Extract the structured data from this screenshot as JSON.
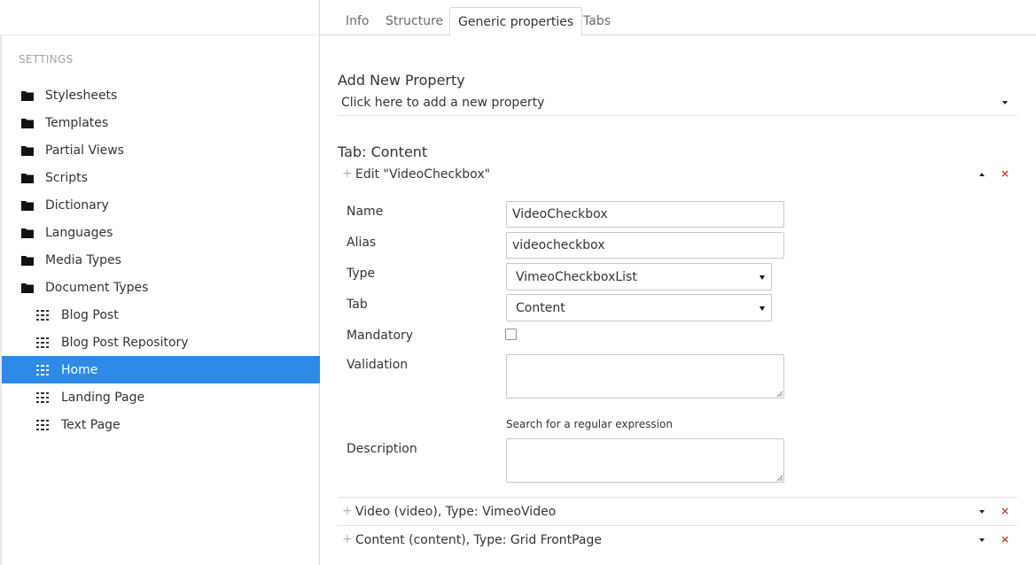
{
  "sidebar": {
    "heading": "SETTINGS",
    "folders": [
      {
        "label": "Stylesheets",
        "icon": "folder-icon"
      },
      {
        "label": "Templates",
        "icon": "folder-icon"
      },
      {
        "label": "Partial Views",
        "icon": "folder-icon"
      },
      {
        "label": "Scripts",
        "icon": "folder-icon"
      },
      {
        "label": "Dictionary",
        "icon": "folder-icon"
      },
      {
        "label": "Languages",
        "icon": "folder-icon"
      },
      {
        "label": "Media Types",
        "icon": "folder-icon"
      },
      {
        "label": "Document Types",
        "icon": "folder-icon"
      }
    ],
    "doc_types": [
      {
        "label": "Blog Post",
        "icon": "grid-icon"
      },
      {
        "label": "Blog Post Repository",
        "icon": "grid-icon"
      },
      {
        "label": "Home",
        "icon": "grid-icon",
        "active": true
      },
      {
        "label": "Landing Page",
        "icon": "grid-icon"
      },
      {
        "label": "Text Page",
        "icon": "grid-icon"
      }
    ]
  },
  "tabs": [
    {
      "label": "Info"
    },
    {
      "label": "Structure"
    },
    {
      "label": "Generic properties",
      "active": true
    },
    {
      "label": "Tabs"
    }
  ],
  "main": {
    "add_heading": "Add New Property",
    "add_select": "Click here to add a new property",
    "tab_heading": "Tab: Content",
    "edit_title": "Edit \"VideoCheckbox\"",
    "form": {
      "name_label": "Name",
      "name_value": "VideoCheckbox",
      "alias_label": "Alias",
      "alias_value": "videocheckbox",
      "type_label": "Type",
      "type_value": "VimeoCheckboxList",
      "tab_label": "Tab",
      "tab_value": "Content",
      "mandatory_label": "Mandatory",
      "mandatory_checked": false,
      "validation_label": "Validation",
      "validation_value": "",
      "regex_link": "Search for a regular expression",
      "description_label": "Description",
      "description_value": ""
    },
    "properties": [
      {
        "title": "Video (video), Type: VimeoVideo"
      },
      {
        "title": "Content (content), Type: Grid FrontPage"
      }
    ]
  },
  "colors": {
    "active_bg": "#2e8ae6",
    "delete": "#b9493d",
    "border": "#d9d9d9"
  }
}
